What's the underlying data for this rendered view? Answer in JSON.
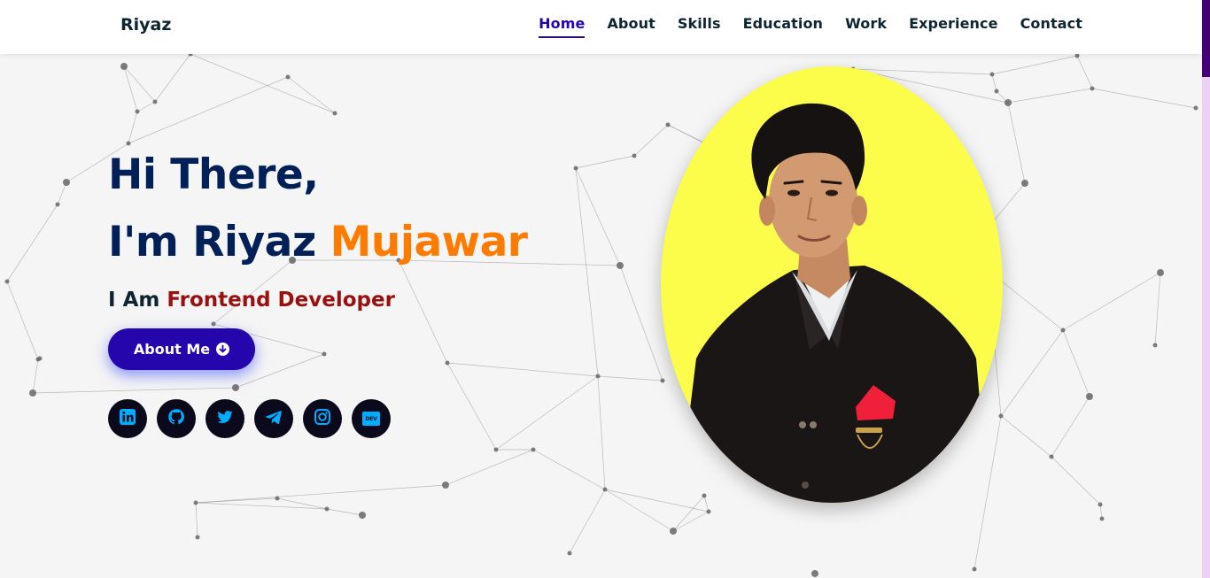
{
  "brand": "Riyaz",
  "nav": {
    "items": [
      {
        "label": "Home",
        "active": true
      },
      {
        "label": "About"
      },
      {
        "label": "Skills"
      },
      {
        "label": "Education"
      },
      {
        "label": "Work"
      },
      {
        "label": "Experience"
      },
      {
        "label": "Contact"
      }
    ]
  },
  "hero": {
    "greeting": "Hi There,",
    "name_prefix": "I'm Riyaz",
    "name_accent": "Mujawar",
    "subtitle_prefix": "I Am",
    "subtitle_role": "Frontend Developer",
    "button_label": "About Me",
    "button_icon": "arrow-circle-down-icon"
  },
  "socials": [
    {
      "icon": "linkedin-icon"
    },
    {
      "icon": "github-icon"
    },
    {
      "icon": "twitter-icon"
    },
    {
      "icon": "telegram-icon"
    },
    {
      "icon": "instagram-icon"
    },
    {
      "icon": "dev-icon",
      "text": "DEV"
    }
  ],
  "colors": {
    "heading": "#002057",
    "accent": "#ff7b00",
    "role": "#991010",
    "primary": "#2506ad",
    "social_bg": "#0b0a1c",
    "social_icon": "#00aeff",
    "portrait_bg": "#fbfd4a"
  }
}
